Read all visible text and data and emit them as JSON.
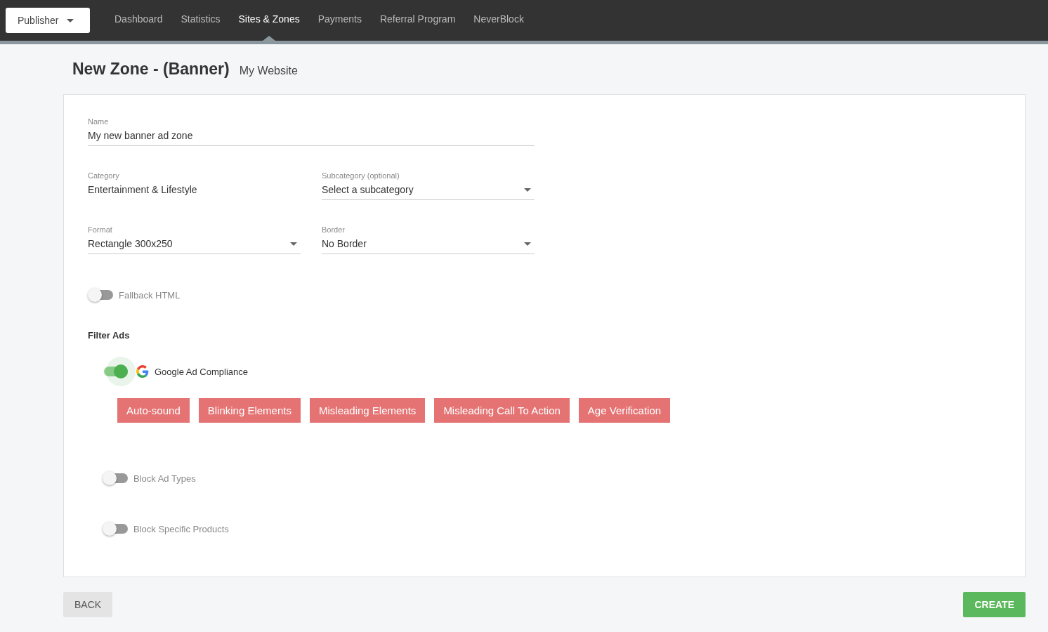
{
  "top_bar": {
    "account_menu": "Publisher",
    "nav": [
      {
        "label": "Dashboard",
        "selected": false
      },
      {
        "label": "Statistics",
        "selected": false
      },
      {
        "label": "Sites & Zones",
        "selected": true
      },
      {
        "label": "Payments",
        "selected": false
      },
      {
        "label": "Referral Program",
        "selected": false
      },
      {
        "label": "NeverBlock",
        "selected": false
      }
    ]
  },
  "page": {
    "title": "New Zone - (Banner)",
    "subtitle": "My Website"
  },
  "form": {
    "name": {
      "label": "Name",
      "value": "My new banner ad zone"
    },
    "fields": [
      {
        "kind": "static",
        "label": "Category",
        "value": "Entertainment & Lifestyle"
      },
      {
        "kind": "select",
        "label": "Subcategory (optional)",
        "value": "Select a subcategory"
      },
      {
        "kind": "select",
        "label": "Format",
        "value": "Rectangle 300x250"
      },
      {
        "kind": "select",
        "label": "Border",
        "value": "No Border"
      }
    ],
    "fallback_html": {
      "label": "Fallback HTML",
      "on": false
    },
    "filter_ads": {
      "heading": "Filter Ads",
      "filters": [
        {
          "kind": "google",
          "label": "Google Ad Compliance",
          "on": true,
          "tags": [
            "Auto-sound",
            "Blinking Elements",
            "Misleading Elements",
            "Misleading Call To Action",
            "Age Verification"
          ]
        },
        {
          "kind": "plain",
          "label": "Block Ad Types",
          "on": false
        },
        {
          "kind": "plain",
          "label": "Block Specific Products",
          "on": false
        }
      ]
    }
  },
  "buttons": {
    "back": "BACK",
    "create": "CREATE"
  }
}
